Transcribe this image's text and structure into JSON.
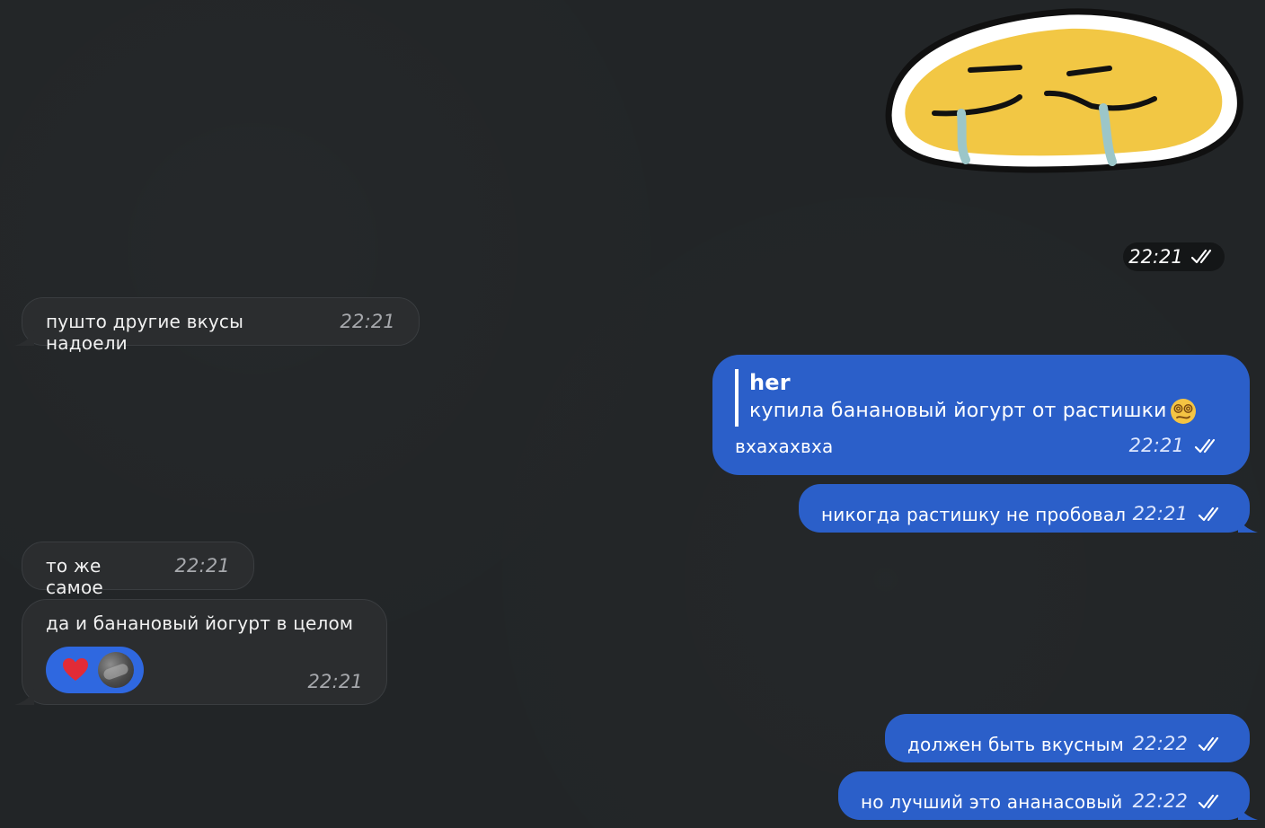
{
  "chat": {
    "sticker": {
      "name": "crying-smile-sticker",
      "time": "22:21"
    },
    "messages": [
      {
        "direction": "incoming",
        "text": "пушто другие вкусы надоели",
        "time": "22:21"
      },
      {
        "direction": "outgoing",
        "reply_to": {
          "author": "her",
          "text": "купила банановый йогурт от растишки",
          "emoji": "dizzy-face"
        },
        "text": "вхахахвха",
        "time": "22:21"
      },
      {
        "direction": "outgoing",
        "text": "никогда растишку не пробовал",
        "time": "22:21"
      },
      {
        "direction": "incoming",
        "text": "то же самое",
        "time": "22:21"
      },
      {
        "direction": "incoming",
        "text": "да и банановый йогурт в целом",
        "time": "22:21",
        "reactions": [
          {
            "emoji": "red-heart",
            "icon": "heart-icon"
          }
        ]
      },
      {
        "direction": "outgoing",
        "text": "должен быть вкусным",
        "time": "22:22"
      },
      {
        "direction": "outgoing",
        "text": "но лучший это ананасовый",
        "time": "22:22"
      }
    ]
  },
  "colors": {
    "background": "#222527",
    "incoming_bubble": "#2b2d2f",
    "outgoing_bubble": "#2b5fc9",
    "reaction_bubble": "#2f68e0"
  }
}
